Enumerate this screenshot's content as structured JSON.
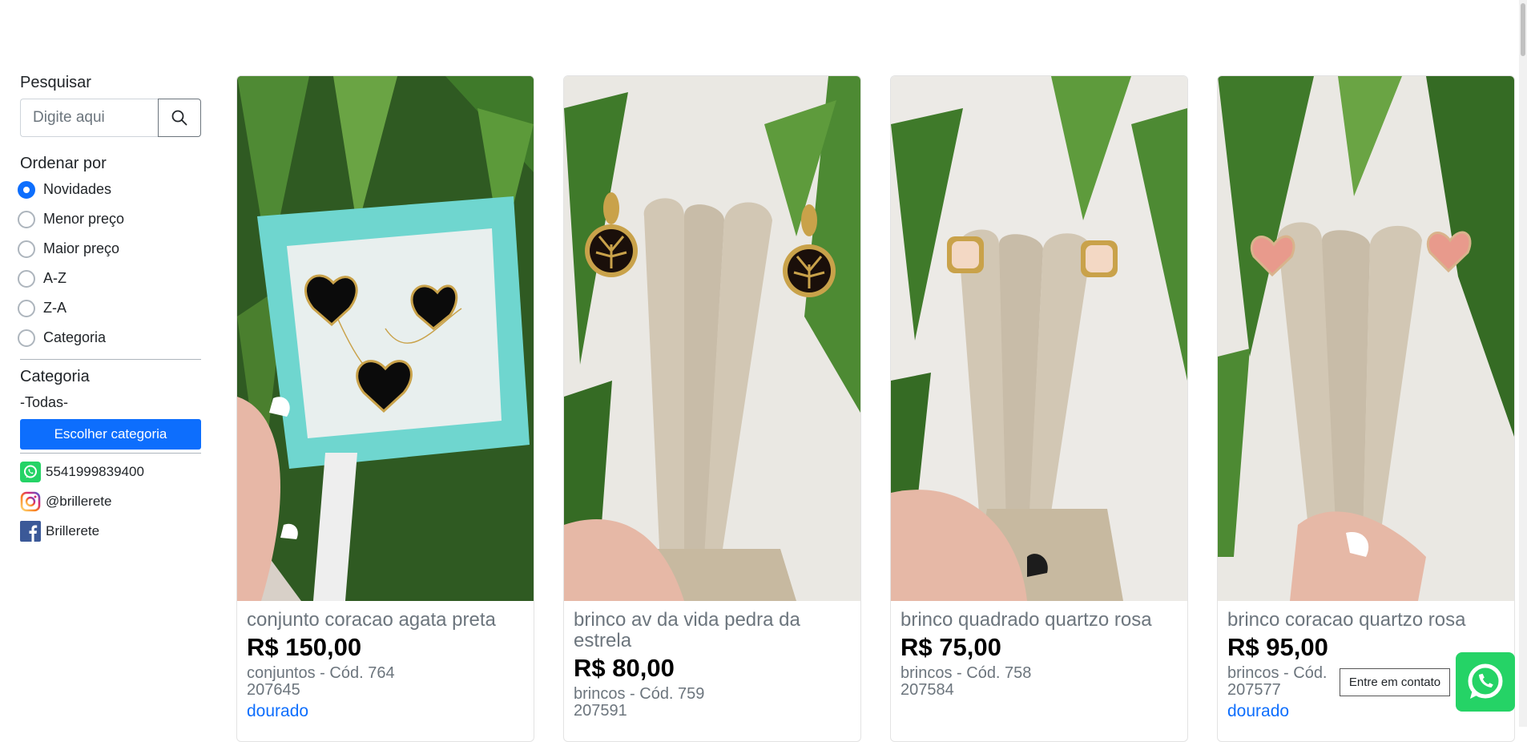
{
  "sidebar": {
    "search_label": "Pesquisar",
    "search_placeholder": "Digite aqui",
    "sort_label": "Ordenar por",
    "sort_options": [
      {
        "label": "Novidades",
        "checked": true
      },
      {
        "label": "Menor preço",
        "checked": false
      },
      {
        "label": "Maior preço",
        "checked": false
      },
      {
        "label": "A-Z",
        "checked": false
      },
      {
        "label": "Z-A",
        "checked": false
      },
      {
        "label": "Categoria",
        "checked": false
      }
    ],
    "category_label": "Categoria",
    "category_value": "-Todas-",
    "category_button": "Escolher categoria",
    "contacts": {
      "whatsapp": "5541999839400",
      "instagram": "@brillerete",
      "facebook": "Brillerete"
    }
  },
  "products": [
    {
      "title": "conjunto coracao agata preta",
      "price": "R$ 150,00",
      "meta_line1": "conjuntos - Cód. 764",
      "meta_line2": "207645",
      "variant": "dourado"
    },
    {
      "title": "brinco av da vida pedra da estrela",
      "price": "R$ 80,00",
      "meta_line1": "brincos - Cód. 759",
      "meta_line2": "207591",
      "variant": ""
    },
    {
      "title": "brinco quadrado quartzo rosa",
      "price": "R$ 75,00",
      "meta_line1": "brincos - Cód. 758",
      "meta_line2": "207584",
      "variant": ""
    },
    {
      "title": "brinco coracao quartzo rosa",
      "price": "R$ 95,00",
      "meta_line1": "brincos - Cód.",
      "meta_line2": "207577",
      "variant": "dourado"
    }
  ],
  "contact_tooltip": "Entre em contato",
  "colors": {
    "primary": "#0d6efd",
    "whatsapp": "#25d366",
    "teal_box": "#6fd6cf"
  }
}
